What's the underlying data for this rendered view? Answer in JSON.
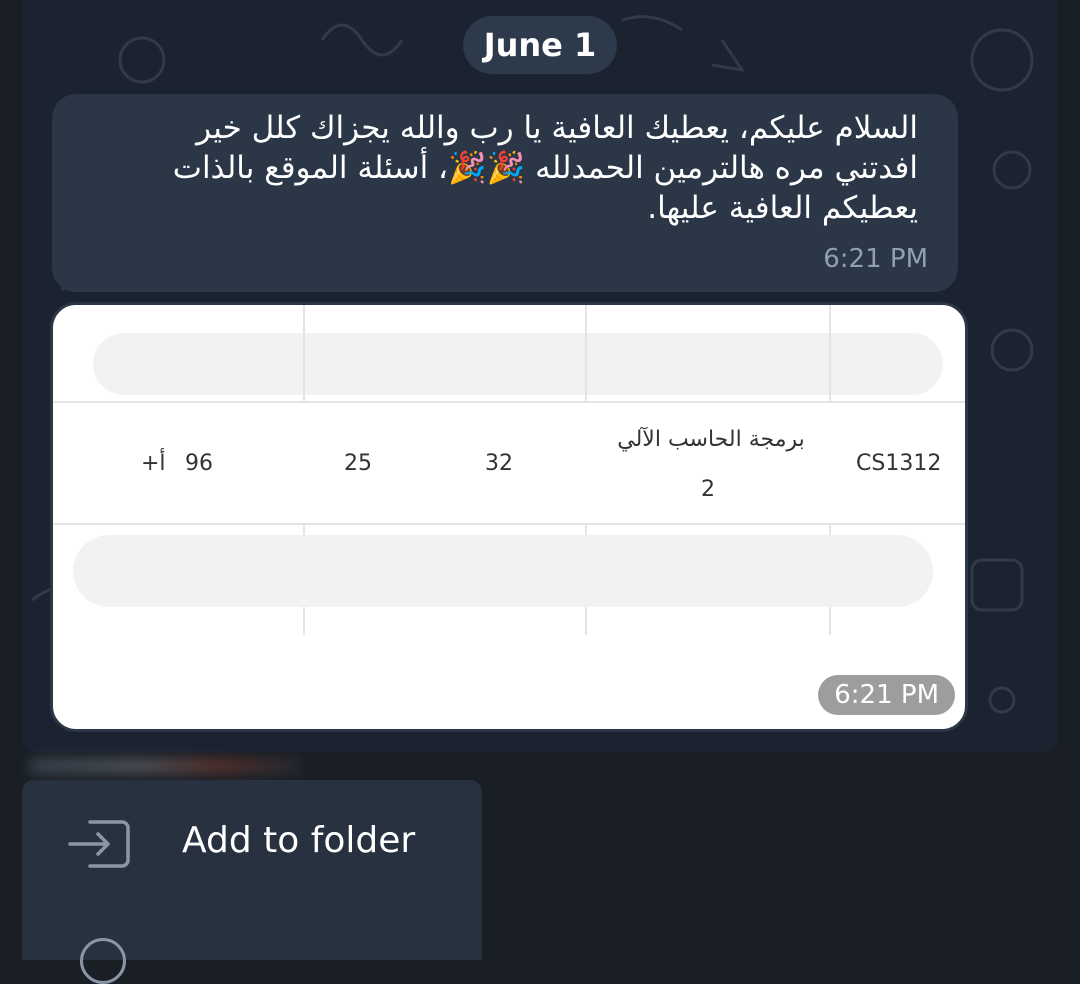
{
  "date_separator": "June 1",
  "message": {
    "text": "السلام عليكم، يعطيك العافية يا رب والله يجزاك كلل خير\nافدتني مره هالترمين الحمدلله 🎉🎉، أسئلة الموقع بالذات\nيعطيكم العافية عليها.",
    "time": "6:21 PM"
  },
  "photo": {
    "row": {
      "code": "CS1312",
      "course_line1": "برمجة الحاسب الآلي",
      "course_line2": "2",
      "num1": "32",
      "num2": "25",
      "num3": "96",
      "grade": "أ+"
    },
    "time": "6:21 PM"
  },
  "context_menu": {
    "items": [
      {
        "label": "Add to folder",
        "icon": "folder-add-icon"
      }
    ]
  }
}
